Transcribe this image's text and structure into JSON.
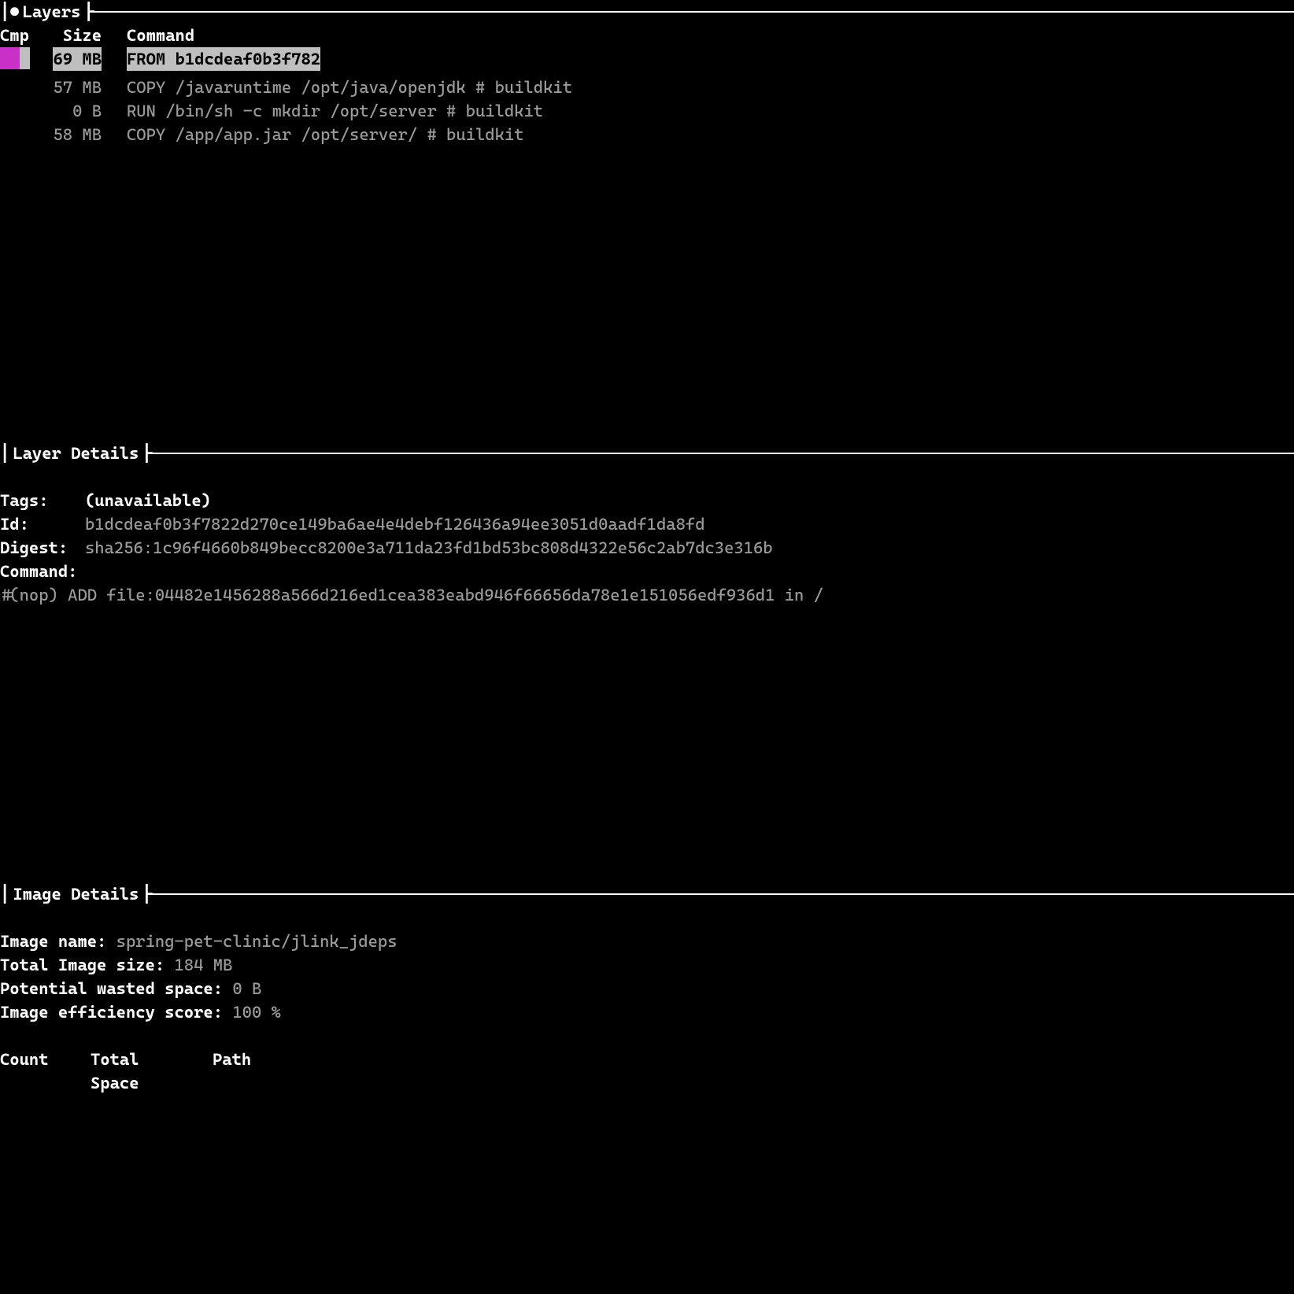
{
  "sections": {
    "layers": {
      "title": "Layers",
      "bullet": "●",
      "columns": {
        "cmp": "Cmp",
        "size": "Size",
        "command": "Command"
      },
      "rows": [
        {
          "cmp": "magenta",
          "selected": true,
          "size": "69 MB",
          "command": "FROM b1dcdeaf0b3f782"
        },
        {
          "cmp": "",
          "selected": false,
          "size": "57 MB",
          "command": "COPY /javaruntime /opt/java/openjdk # buildkit"
        },
        {
          "cmp": "",
          "selected": false,
          "size": "0 B",
          "command": "RUN /bin/sh -c mkdir /opt/server # buildkit"
        },
        {
          "cmp": "",
          "selected": false,
          "size": "58 MB",
          "command": "COPY /app/app.jar /opt/server/ # buildkit"
        }
      ]
    },
    "layer_details": {
      "title": "Layer Details",
      "tags_label": "Tags:",
      "tags_value": "(unavailable)",
      "id_label": "Id:",
      "id_value": "b1dcdeaf0b3f7822d270ce149ba6ae4e4debf126436a94ee3051d0aadf1da8fd",
      "digest_label": "Digest:",
      "digest_value": "sha256:1c96f4660b849becc8200e3a711da23fd1bd53bc808d4322e56c2ab7dc3e316b",
      "command_label": "Command:",
      "command_value": "#(nop) ADD file:04482e1456288a566d216ed1cea383eabd946f66656da78e1e151056edf936d1 in / "
    },
    "image_details": {
      "title": "Image Details",
      "name_label": "Image name:",
      "name_value": "spring-pet-clinic/jlink_jdeps",
      "total_size_label": "Total Image size:",
      "total_size_value": "184 MB",
      "wasted_label": "Potential wasted space:",
      "wasted_value": "0 B",
      "efficiency_label": "Image efficiency score:",
      "efficiency_value": "100 %",
      "waste_columns": {
        "count": "Count",
        "space": "Total Space",
        "path": "Path"
      }
    }
  }
}
